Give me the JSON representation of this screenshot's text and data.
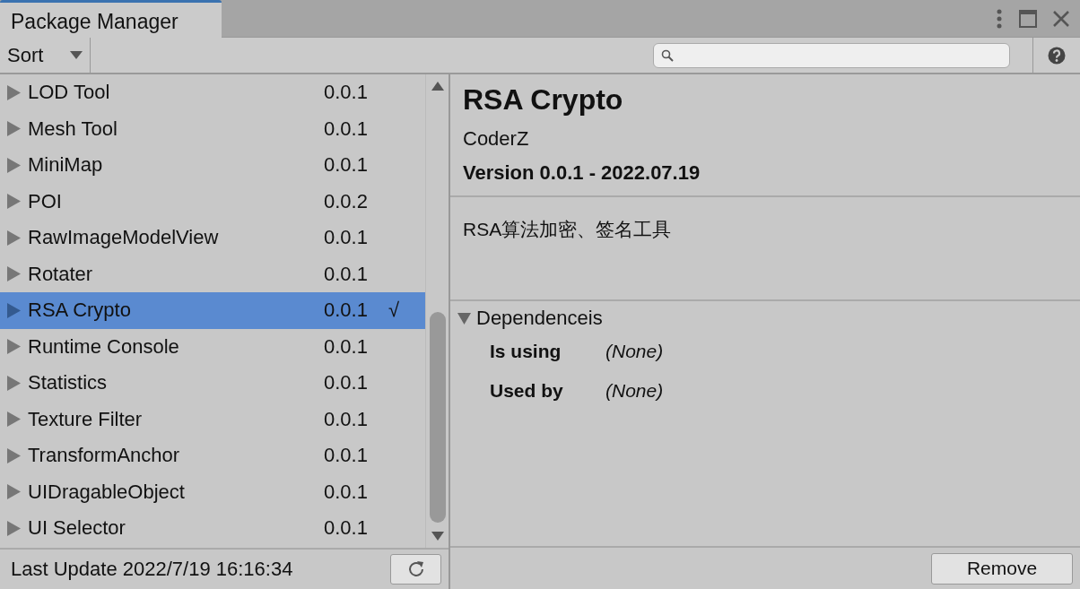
{
  "window": {
    "title": "Package Manager"
  },
  "toolbar": {
    "sort_label": "Sort"
  },
  "packages": [
    {
      "name": "LOD Tool",
      "version": "0.0.1",
      "selected": false
    },
    {
      "name": "Mesh Tool",
      "version": "0.0.1",
      "selected": false
    },
    {
      "name": "MiniMap",
      "version": "0.0.1",
      "selected": false
    },
    {
      "name": "POI",
      "version": "0.0.2",
      "selected": false
    },
    {
      "name": "RawImageModelView",
      "version": "0.0.1",
      "selected": false
    },
    {
      "name": "Rotater",
      "version": "0.0.1",
      "selected": false
    },
    {
      "name": "RSA Crypto",
      "version": "0.0.1",
      "selected": true,
      "mark": "√"
    },
    {
      "name": "Runtime Console",
      "version": "0.0.1",
      "selected": false
    },
    {
      "name": "Statistics",
      "version": "0.0.1",
      "selected": false
    },
    {
      "name": "Texture Filter",
      "version": "0.0.1",
      "selected": false
    },
    {
      "name": "TransformAnchor",
      "version": "0.0.1",
      "selected": false
    },
    {
      "name": "UIDragableObject",
      "version": "0.0.1",
      "selected": false
    },
    {
      "name": "UI Selector",
      "version": "0.0.1",
      "selected": false
    }
  ],
  "status_bar": {
    "text": "Last Update 2022/7/19 16:16:34"
  },
  "details": {
    "title": "RSA Crypto",
    "author": "CoderZ",
    "version": "Version 0.0.1 - 2022.07.19",
    "description": "RSA算法加密、签名工具",
    "dependencies": {
      "label": "Dependenceis",
      "expanded": true,
      "rows": [
        {
          "label": "Is using",
          "value": "(None)"
        },
        {
          "label": "Used by",
          "value": "(None)"
        }
      ]
    },
    "buttons": [
      "Remove"
    ]
  }
}
